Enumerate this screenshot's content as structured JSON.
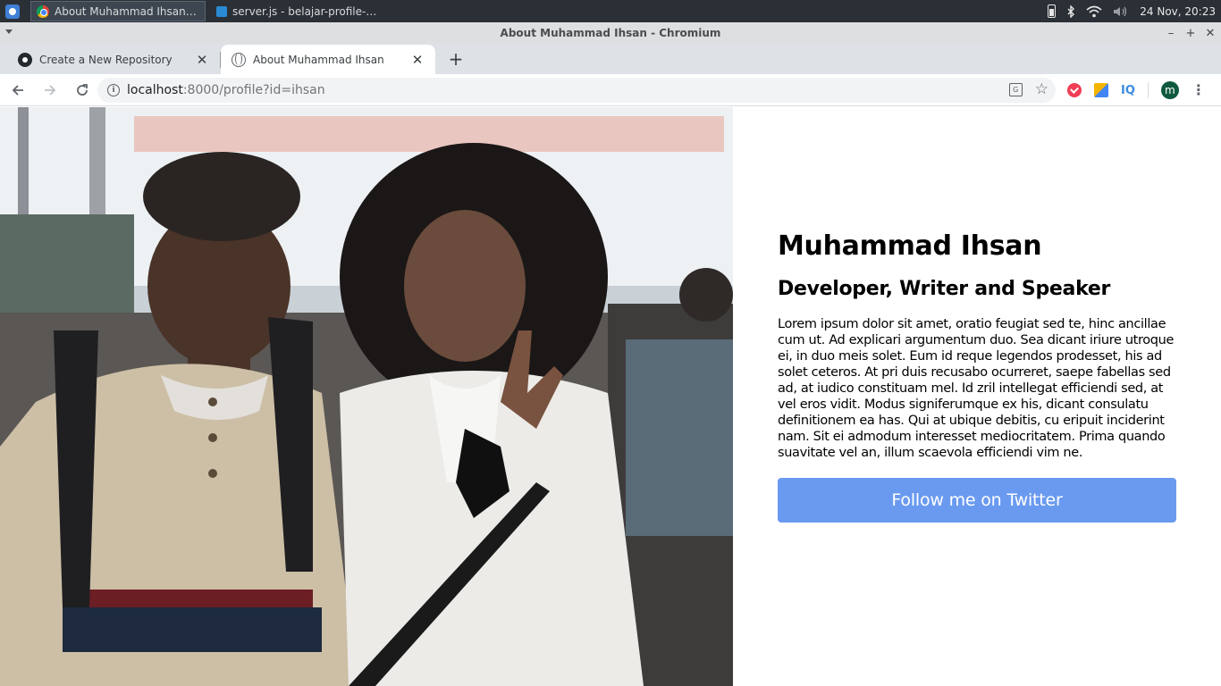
{
  "taskbar": {
    "tasks": [
      {
        "label": "About Muhammad Ihsan - C...",
        "icon": "chromium-icon",
        "active": true
      },
      {
        "label": "server.js - belajar-profile-we...",
        "icon": "vscode-icon",
        "active": false
      }
    ],
    "clock": "24 Nov, 20:23"
  },
  "window": {
    "title": "About Muhammad Ihsan - Chromium"
  },
  "tabs": [
    {
      "label": "Create a New Repository",
      "favicon": "github-icon",
      "active": false
    },
    {
      "label": "About Muhammad Ihsan",
      "favicon": "globe-icon",
      "active": true
    }
  ],
  "toolbar": {
    "url_host": "localhost",
    "url_rest": ":8000/profile?id=ihsan",
    "avatar_letter": "m",
    "extensions": [
      "pocket-icon",
      "edit-extension-icon",
      "iq-extension-icon"
    ],
    "iq_label": "IQ"
  },
  "profile": {
    "name": "Muhammad Ihsan",
    "tagline": "Developer, Writer and Speaker",
    "bio": "Lorem ipsum dolor sit amet, oratio feugiat sed te, hinc ancillae cum ut. Ad explicari argumentum duo. Sea dicant iriure utroque ei, in duo meis solet. Eum id reque legendos prodesset, his ad solet ceteros. At pri duis recusabo ocurreret, saepe fabellas sed ad, at iudico constituam mel. Id zril intellegat efficiendi sed, at vel eros vidit. Modus signiferumque ex his, dicant consulatu definitionem ea has. Qui at ubique debitis, cu eripuit inciderint nam. Sit ei admodum interesset mediocritatem. Prima quando suavitate vel an, illum scaevola efficiendi vim ne.",
    "button_label": "Follow me on Twitter"
  },
  "colors": {
    "button": "#6a9af0",
    "taskbar": "#2b3036"
  }
}
